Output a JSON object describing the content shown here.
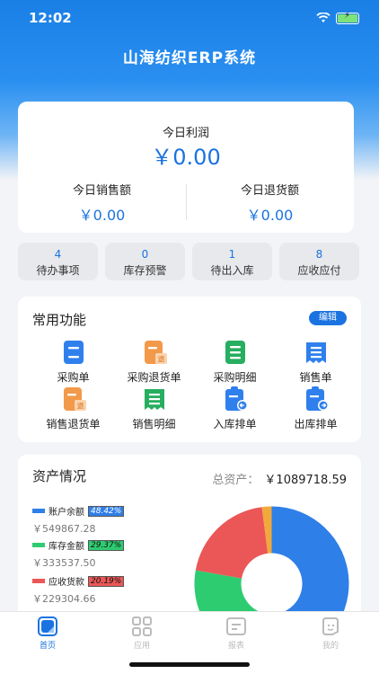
{
  "status": {
    "time": "12:02"
  },
  "header": {
    "title": "山海纺织ERP系统"
  },
  "profit": {
    "label": "今日利润",
    "value": "￥0.00",
    "sales_label": "今日销售额",
    "sales_value": "￥0.00",
    "return_label": "今日退货额",
    "return_value": "￥0.00"
  },
  "stats": [
    {
      "count": "4",
      "label": "待办事项"
    },
    {
      "count": "0",
      "label": "库存预警"
    },
    {
      "count": "1",
      "label": "待出入库"
    },
    {
      "count": "8",
      "label": "应收应付"
    }
  ],
  "functions": {
    "title": "常用功能",
    "edit_label": "编辑",
    "items": [
      {
        "label": "采购单",
        "icon": "purchase-order-icon",
        "color": "#2f80ed"
      },
      {
        "label": "采购退货单",
        "icon": "purchase-return-icon",
        "color": "#f2994a",
        "badge": "退"
      },
      {
        "label": "采购明细",
        "icon": "purchase-detail-icon",
        "color": "#27ae60"
      },
      {
        "label": "销售单",
        "icon": "sales-order-icon",
        "color": "#2f80ed"
      },
      {
        "label": "销售退货单",
        "icon": "sales-return-icon",
        "color": "#f2994a",
        "badge": "退"
      },
      {
        "label": "销售明细",
        "icon": "sales-detail-icon",
        "color": "#27ae60"
      },
      {
        "label": "入库排单",
        "icon": "inbound-schedule-icon",
        "color": "#2f80ed"
      },
      {
        "label": "出库排单",
        "icon": "outbound-schedule-icon",
        "color": "#2f80ed"
      }
    ]
  },
  "assets": {
    "title": "资产情况",
    "total_label": "总资产：",
    "total_value": "￥1089718.59",
    "legend": [
      {
        "label": "账户余额",
        "percent": "48.42%",
        "amount": "￥549867.28",
        "color": "#2f7fe8"
      },
      {
        "label": "库存金额",
        "percent": "29.37%",
        "amount": "￥333537.50",
        "color": "#2ecc71"
      },
      {
        "label": "应收货款",
        "percent": "20.19%",
        "amount": "￥229304.66",
        "color": "#eb5757"
      }
    ],
    "slices": [
      {
        "name": "账户余额",
        "value": 48.42,
        "color": "#2f7fe8"
      },
      {
        "name": "库存金额",
        "value": 29.37,
        "color": "#2ecc71"
      },
      {
        "name": "应收货款",
        "value": 20.19,
        "color": "#eb5757"
      },
      {
        "name": "other",
        "value": 2.02,
        "color": "#f2a93b"
      }
    ]
  },
  "tabbar": [
    {
      "label": "首页",
      "icon": "home-icon",
      "active": true
    },
    {
      "label": "应用",
      "icon": "apps-icon",
      "active": false
    },
    {
      "label": "报表",
      "icon": "report-icon",
      "active": false
    },
    {
      "label": "我的",
      "icon": "profile-icon",
      "active": false
    }
  ]
}
